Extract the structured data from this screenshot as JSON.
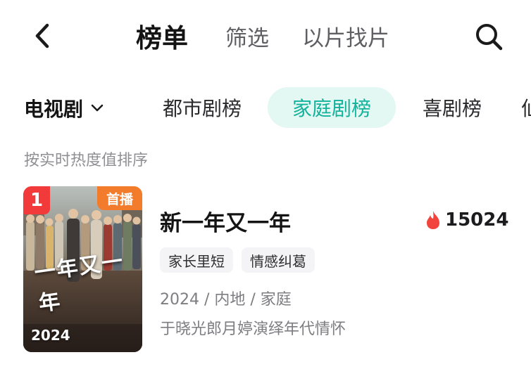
{
  "header": {
    "tabs": [
      {
        "label": "榜单",
        "active": true
      },
      {
        "label": "筛选",
        "active": false
      },
      {
        "label": "以片找片",
        "active": false
      }
    ],
    "back_icon": "chevron-left-icon",
    "search_icon": "search-icon"
  },
  "categories": {
    "dropdown_label": "电视剧",
    "dropdown_icon": "chevron-down-icon",
    "chips": [
      {
        "label": "都市剧榜",
        "selected": false
      },
      {
        "label": "家庭剧榜",
        "selected": true
      },
      {
        "label": "喜剧榜",
        "selected": false
      },
      {
        "label": "仙",
        "selected": false
      }
    ],
    "accent_color": "#12b29b",
    "accent_bg": "#e3f7f3"
  },
  "sort_label": "按实时热度值排序",
  "items": [
    {
      "rank": "1",
      "badge": "首播",
      "poster_year": "2024",
      "poster_title": "一年又一年",
      "title": "新一年又一年",
      "heat_icon": "flame-icon",
      "heat": "15024",
      "tags": [
        "家长里短",
        "情感纠葛"
      ],
      "meta": "2024 / 内地 / 家庭",
      "description": "于晓光郎月婷演绎年代情怀"
    }
  ]
}
